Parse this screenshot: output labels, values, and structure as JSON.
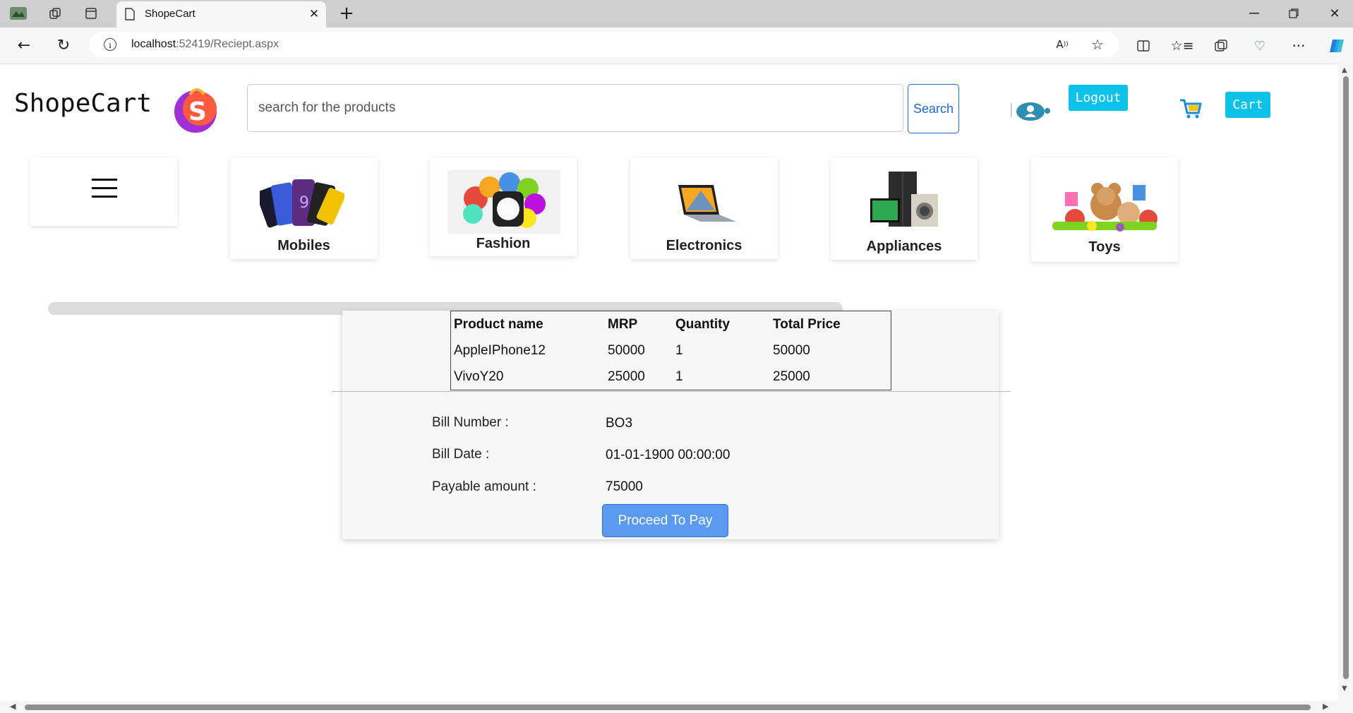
{
  "browser": {
    "tab_title": "ShopeCart",
    "url_host": "localhost",
    "url_rest": ":52419/Reciept.aspx"
  },
  "header": {
    "brand": "ShopeCart",
    "search_placeholder": "search for the products",
    "search_label": "Search",
    "logout_label": "Logout",
    "cart_label": "Cart"
  },
  "categories": [
    {
      "label": "Mobiles"
    },
    {
      "label": "Fashion"
    },
    {
      "label": "Electronics"
    },
    {
      "label": "Appliances"
    },
    {
      "label": "Toys"
    }
  ],
  "receipt": {
    "columns": [
      "Product name",
      "MRP",
      "Quantity",
      "Total Price"
    ],
    "rows": [
      [
        "AppleIPhone12",
        "50000",
        "1",
        "50000"
      ],
      [
        "VivoY20",
        "25000",
        "1",
        "25000"
      ]
    ],
    "bill_number_label": "Bill Number :",
    "bill_number": "BO3",
    "bill_date_label": "Bill Date :",
    "bill_date": "01-01-1900 00:00:00",
    "payable_label": "Payable amount :",
    "payable": "75000",
    "pay_label": "Proceed To Pay"
  },
  "colors": {
    "accent": "#0dc2e8",
    "pay_button": "#5a9bf0",
    "search_border": "#1e6ae0"
  }
}
